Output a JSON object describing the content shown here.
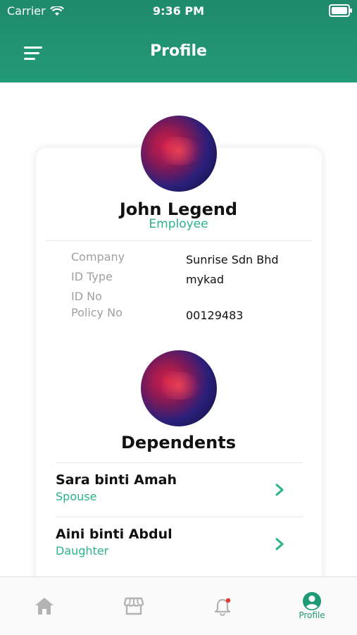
{
  "status_bar": {
    "carrier": "Carrier",
    "time": "9:36 PM"
  },
  "header": {
    "title": "Profile",
    "menu_icon": "menu-icon"
  },
  "profile": {
    "name": "John Legend",
    "role": "Employee",
    "fields": [
      {
        "label": "Company",
        "value": "Sunrise Sdn Bhd"
      },
      {
        "label": "ID Type",
        "value": "mykad"
      },
      {
        "label": "ID No",
        "value": ""
      },
      {
        "label": "Policy No",
        "value": "00129483"
      }
    ]
  },
  "dependents": {
    "title": "Dependents",
    "items": [
      {
        "name": "Sara binti Amah",
        "relation": "Spouse"
      },
      {
        "name": "Aini binti Abdul",
        "relation": "Daughter"
      }
    ]
  },
  "tabbar": {
    "tabs": [
      {
        "icon": "home-icon",
        "label": ""
      },
      {
        "icon": "store-icon",
        "label": ""
      },
      {
        "icon": "bell-icon",
        "label": ""
      },
      {
        "icon": "profile-icon",
        "label": "Profile",
        "active": true
      }
    ]
  },
  "colors": {
    "accent": "#2bb38b",
    "header": "#1f8a6c",
    "notification_dot": "#e53935"
  }
}
